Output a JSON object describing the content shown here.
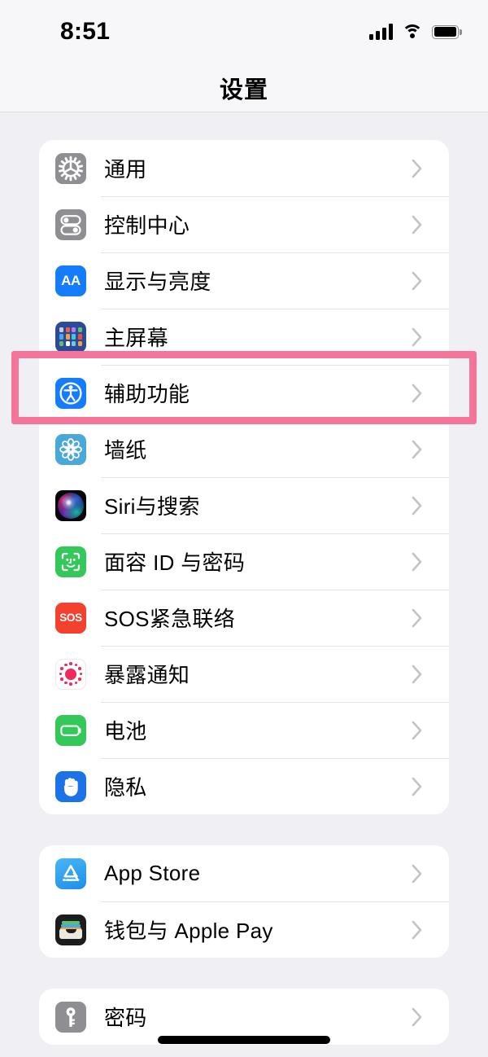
{
  "status_bar": {
    "time": "8:51",
    "signal_icon": "cellular-signal-icon",
    "wifi_icon": "wifi-icon",
    "battery_icon": "battery-full-icon"
  },
  "nav": {
    "title": "设置"
  },
  "highlight": {
    "color": "#F5759A",
    "target_row": "辅助功能"
  },
  "groups": [
    {
      "id": "system-group",
      "rows": [
        {
          "label": "通用",
          "icon": "gear-icon",
          "icon_style": "ico-gear",
          "chevron": true
        },
        {
          "label": "控制中心",
          "icon": "control-center-icon",
          "icon_style": "ico-cc",
          "chevron": true
        },
        {
          "label": "显示与亮度",
          "icon": "display-brightness-icon",
          "icon_style": "ico-aa",
          "chevron": true
        },
        {
          "label": "主屏幕",
          "icon": "home-screen-icon",
          "icon_style": "ico-home",
          "chevron": true
        },
        {
          "label": "辅助功能",
          "icon": "accessibility-icon",
          "icon_style": "ico-acc",
          "chevron": true
        },
        {
          "label": "墙纸",
          "icon": "wallpaper-icon",
          "icon_style": "ico-wall",
          "chevron": true
        },
        {
          "label": "Siri与搜索",
          "icon": "siri-icon",
          "icon_style": "ico-siri",
          "chevron": true
        },
        {
          "label": "面容 ID 与密码",
          "icon": "face-id-icon",
          "icon_style": "ico-face",
          "chevron": true
        },
        {
          "label": "SOS紧急联络",
          "icon": "sos-icon",
          "icon_style": "ico-sos",
          "chevron": true
        },
        {
          "label": "暴露通知",
          "icon": "exposure-notification-icon",
          "icon_style": "ico-expo",
          "chevron": true
        },
        {
          "label": "电池",
          "icon": "battery-icon",
          "icon_style": "ico-batt",
          "chevron": true
        },
        {
          "label": "隐私",
          "icon": "privacy-hand-icon",
          "icon_style": "ico-priv",
          "chevron": true
        }
      ]
    },
    {
      "id": "store-group",
      "rows": [
        {
          "label": "App Store",
          "icon": "app-store-icon",
          "icon_style": "ico-appsto",
          "chevron": true
        },
        {
          "label": "钱包与 Apple Pay",
          "icon": "wallet-icon",
          "icon_style": "ico-wallet",
          "chevron": true
        }
      ]
    },
    {
      "id": "passwords-group",
      "rows": [
        {
          "label": "密码",
          "icon": "passwords-key-icon",
          "icon_style": "ico-pass",
          "chevron": true
        }
      ]
    }
  ]
}
